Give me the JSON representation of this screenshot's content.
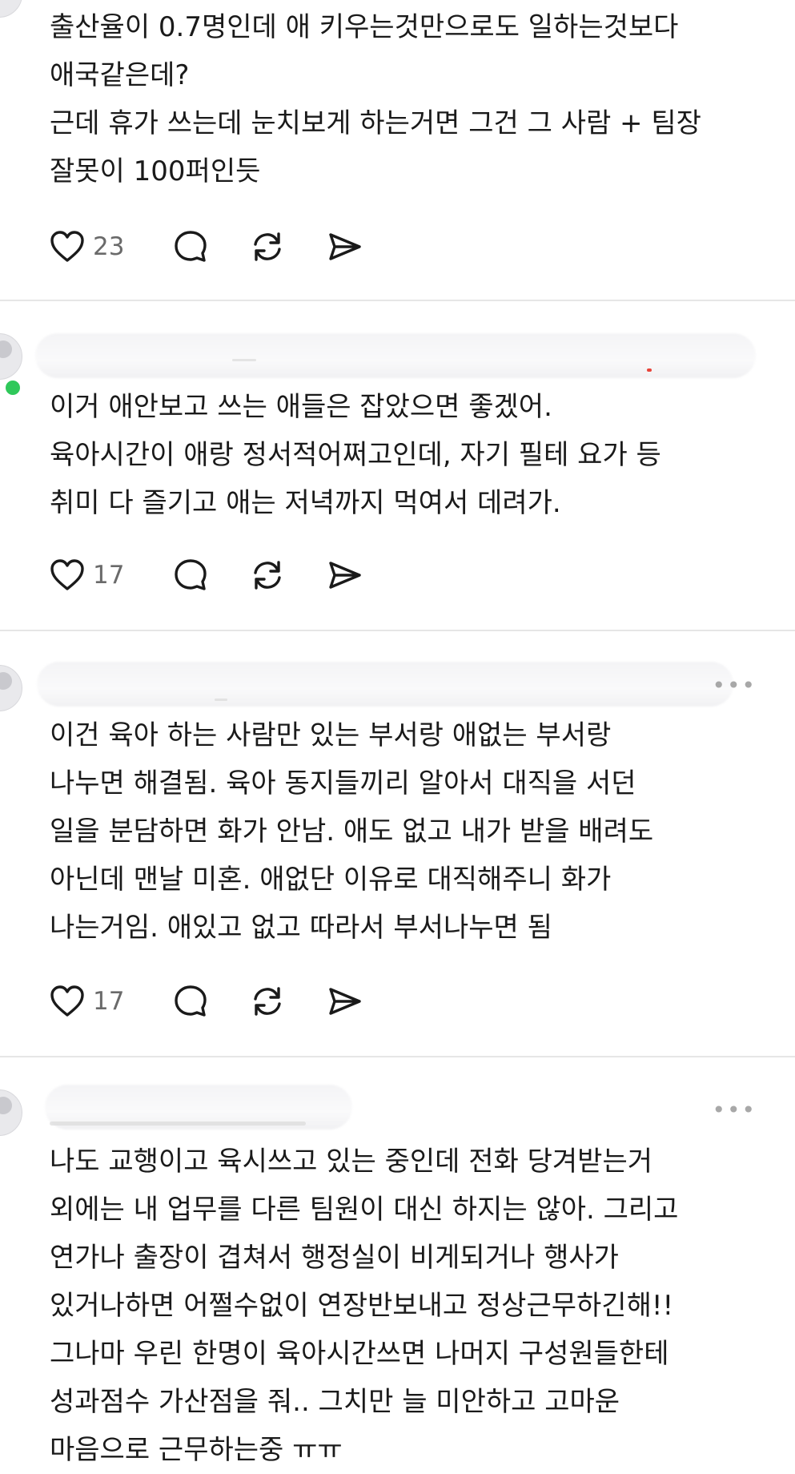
{
  "posts": [
    {
      "text": "출산율이 0.7명인데 애 키우는것만으로도 일하는것보다\n애국같은데?\n근데 휴가 쓰는데 눈치보게 하는거면 그건 그 사람 + 팀장\n잘못이 100퍼인듯",
      "likes": "23"
    },
    {
      "text": "이거 애안보고 쓰는 애들은 잡았으면 좋겠어.\n육아시간이 애랑 정서적어쩌고인데, 자기 필테 요가 등\n취미 다 즐기고 애는 저녁까지 먹여서 데려가.",
      "likes": "17"
    },
    {
      "text": "이건 육아 하는 사람만 있는 부서랑 애없는 부서랑\n나누면 해결됨. 육아 동지들끼리 알아서 대직을 서던\n일을 분담하면 화가 안남. 애도 없고 내가 받을 배려도\n아닌데 맨날 미혼. 애없단 이유로 대직해주니 화가\n나는거임. 애있고 없고 따라서 부서나누면 됨",
      "likes": "17"
    },
    {
      "text": "나도 교행이고 육시쓰고 있는 중인데 전화 당겨받는거\n외에는 내 업무를 다른 팀원이 대신 하지는 않아. 그리고\n연가나 출장이 겹쳐서 행정실이 비게되거나 행사가\n있거나하면 어쩔수없이 연장반보내고 정상근무하긴해!!\n그나마 우린 한명이 육아시간쓰면 나머지 구성원들한테\n성과점수 가산점을 줘.. 그치만 늘 미안하고 고마운\n마음으로 근무하는중 ㅠㅠ"
    }
  ],
  "icons": {
    "like": "heart-outline-icon",
    "reply": "speech-bubble-icon",
    "repost": "repost-arrows-icon",
    "share": "paper-plane-icon",
    "more": "more-dots-icon"
  },
  "more_glyph": "•••",
  "colors": {
    "text": "#1a1a1a",
    "muted": "#6a6a6a",
    "divider": "#e6e6e6",
    "online": "#2fc85a"
  }
}
